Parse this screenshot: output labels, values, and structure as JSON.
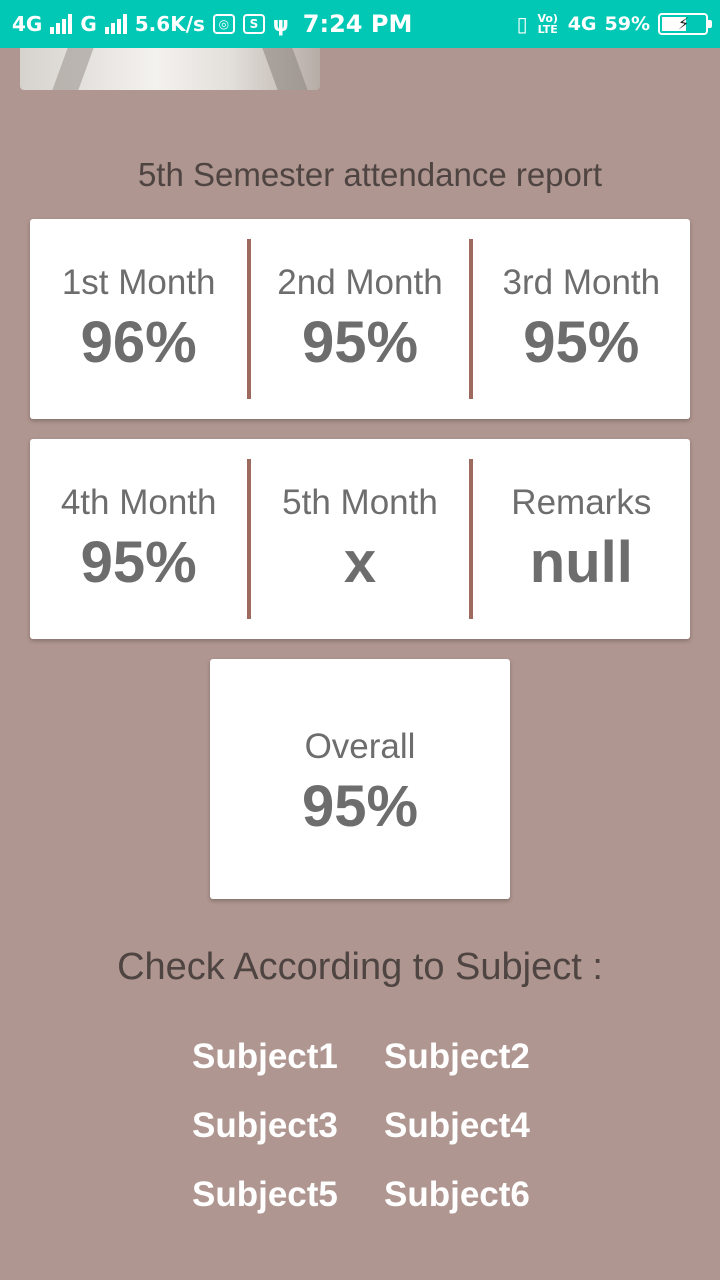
{
  "status_bar": {
    "net1": "4G",
    "net2": "G",
    "speed": "5.6K/s",
    "time": "7:24 PM",
    "volte": "Vo) LTE",
    "net3": "4G",
    "battery": "59%"
  },
  "report": {
    "title": "5th Semester attendance report",
    "months": [
      {
        "label": "1st Month",
        "value": "96%"
      },
      {
        "label": "2nd Month",
        "value": "95%"
      },
      {
        "label": "3rd Month",
        "value": "95%"
      },
      {
        "label": "4th Month",
        "value": "95%"
      },
      {
        "label": "5th Month",
        "value": "x"
      },
      {
        "label": "Remarks",
        "value": "null"
      }
    ],
    "overall": {
      "label": "Overall",
      "value": "95%"
    }
  },
  "subjects": {
    "title": "Check According to Subject :",
    "items": [
      "Subject1",
      "Subject2",
      "Subject3",
      "Subject4",
      "Subject5",
      "Subject6"
    ]
  }
}
